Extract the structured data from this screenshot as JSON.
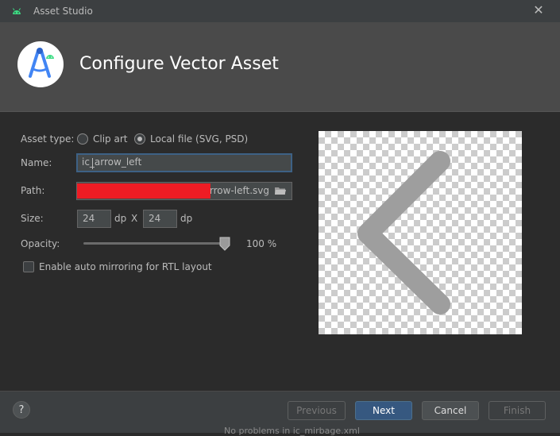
{
  "window": {
    "title": "Asset Studio",
    "close_glyph": "✕"
  },
  "header": {
    "title": "Configure Vector Asset"
  },
  "form": {
    "asset_type_label": "Asset type:",
    "asset_type_options": [
      "Clip art",
      "Local file (SVG, PSD)"
    ],
    "asset_type_selected": "Local file (SVG, PSD)",
    "name_label": "Name:",
    "name_value": "ic_arrow_left",
    "path_label": "Path:",
    "path_value_visible": "arrow-left.svg",
    "size_label": "Size:",
    "width_value": "24",
    "height_value": "24",
    "unit": "dp",
    "size_separator": "X",
    "opacity_label": "Opacity:",
    "opacity_value": 1.0,
    "opacity_text": "100 %",
    "rtl_label": "Enable auto mirroring for RTL layout",
    "rtl_checked": false
  },
  "preview": {
    "icon": "arrow-left-icon",
    "icon_color": "#9e9e9e"
  },
  "footer": {
    "help_glyph": "?",
    "previous_label": "Previous",
    "next_label": "Next",
    "cancel_label": "Cancel",
    "finish_label": "Finish",
    "status_text": "No problems in ic_mirbage.xml"
  },
  "colors": {
    "accent": "#365880",
    "focus_border": "#3d6185",
    "redaction": "#ee1c24"
  }
}
